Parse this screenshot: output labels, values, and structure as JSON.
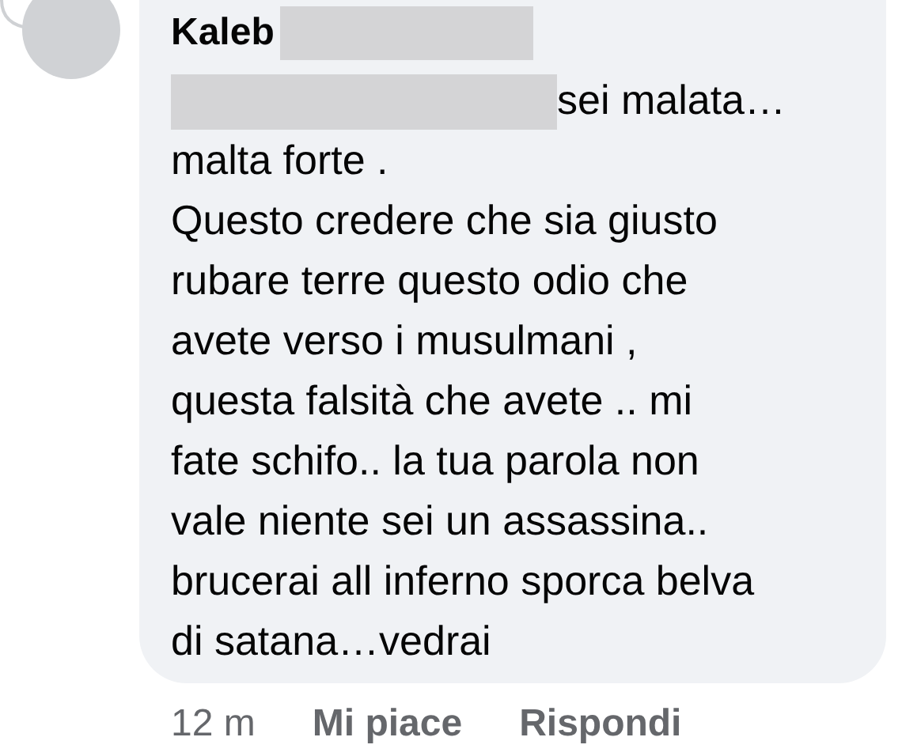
{
  "comment": {
    "author": "Kaleb",
    "first_line_end": "sei malata…",
    "body": "malta forte .\nQuesto credere che sia giusto\nrubare terre questo odio che\navete verso i musulmani ,\nquesta falsità che avete .. mi\nfate schifo.. la tua parola non\nvale niente sei un assassina..\nbrucerai all inferno sporca belva\ndi satana…vedrai",
    "redacted": true
  },
  "footer": {
    "time": "12 m",
    "actions": [
      {
        "label": "Mi piace"
      },
      {
        "label": "Rispondi"
      }
    ]
  }
}
